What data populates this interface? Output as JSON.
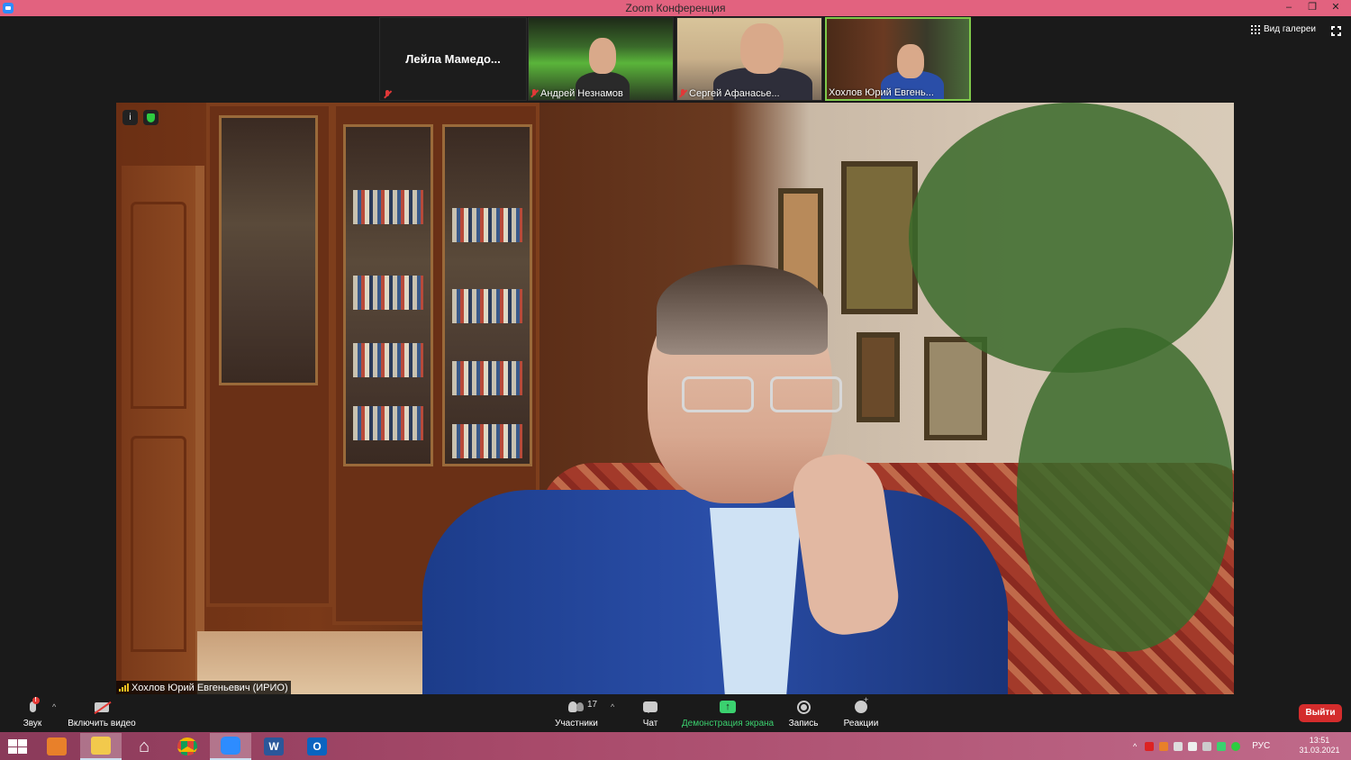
{
  "window": {
    "title": "Zoom Конференция",
    "min_label": "–",
    "max_label": "❐",
    "close_label": "✕"
  },
  "thumbnails": [
    {
      "name": "Лейла Мамедо...",
      "muted": true,
      "video": false
    },
    {
      "name": "Андрей Незнамов",
      "muted": true,
      "video": true
    },
    {
      "name": "Сергей Афанасье...",
      "muted": true,
      "video": true
    },
    {
      "name": "Хохлов Юрий Евгень...",
      "muted": false,
      "video": true,
      "active_speaker": true
    }
  ],
  "view": {
    "gallery_label": "Вид галереи"
  },
  "main_video": {
    "speaker_name": "Хохлов Юрий Евгеньевич (ИРИО)"
  },
  "toolbar": {
    "audio_label": "Звук",
    "video_label": "Включить видео",
    "participants_label": "Участники",
    "participants_count": "17",
    "chat_label": "Чат",
    "share_label": "Демонстрация экрана",
    "record_label": "Запись",
    "reactions_label": "Реакции",
    "leave_label": "Выйти"
  },
  "taskbar": {
    "apps": [
      "media-player-icon",
      "file-explorer-icon",
      "home-icon",
      "chrome-icon",
      "zoom-icon",
      "word-icon",
      "outlook-icon"
    ],
    "language": "РУС",
    "time": "13:51",
    "date": "31.03.2021"
  },
  "colors": {
    "titlebar": "#e2627f",
    "leave": "#d42c2c",
    "share_green": "#3bd16f",
    "active_speaker_border": "#7fc94a"
  }
}
